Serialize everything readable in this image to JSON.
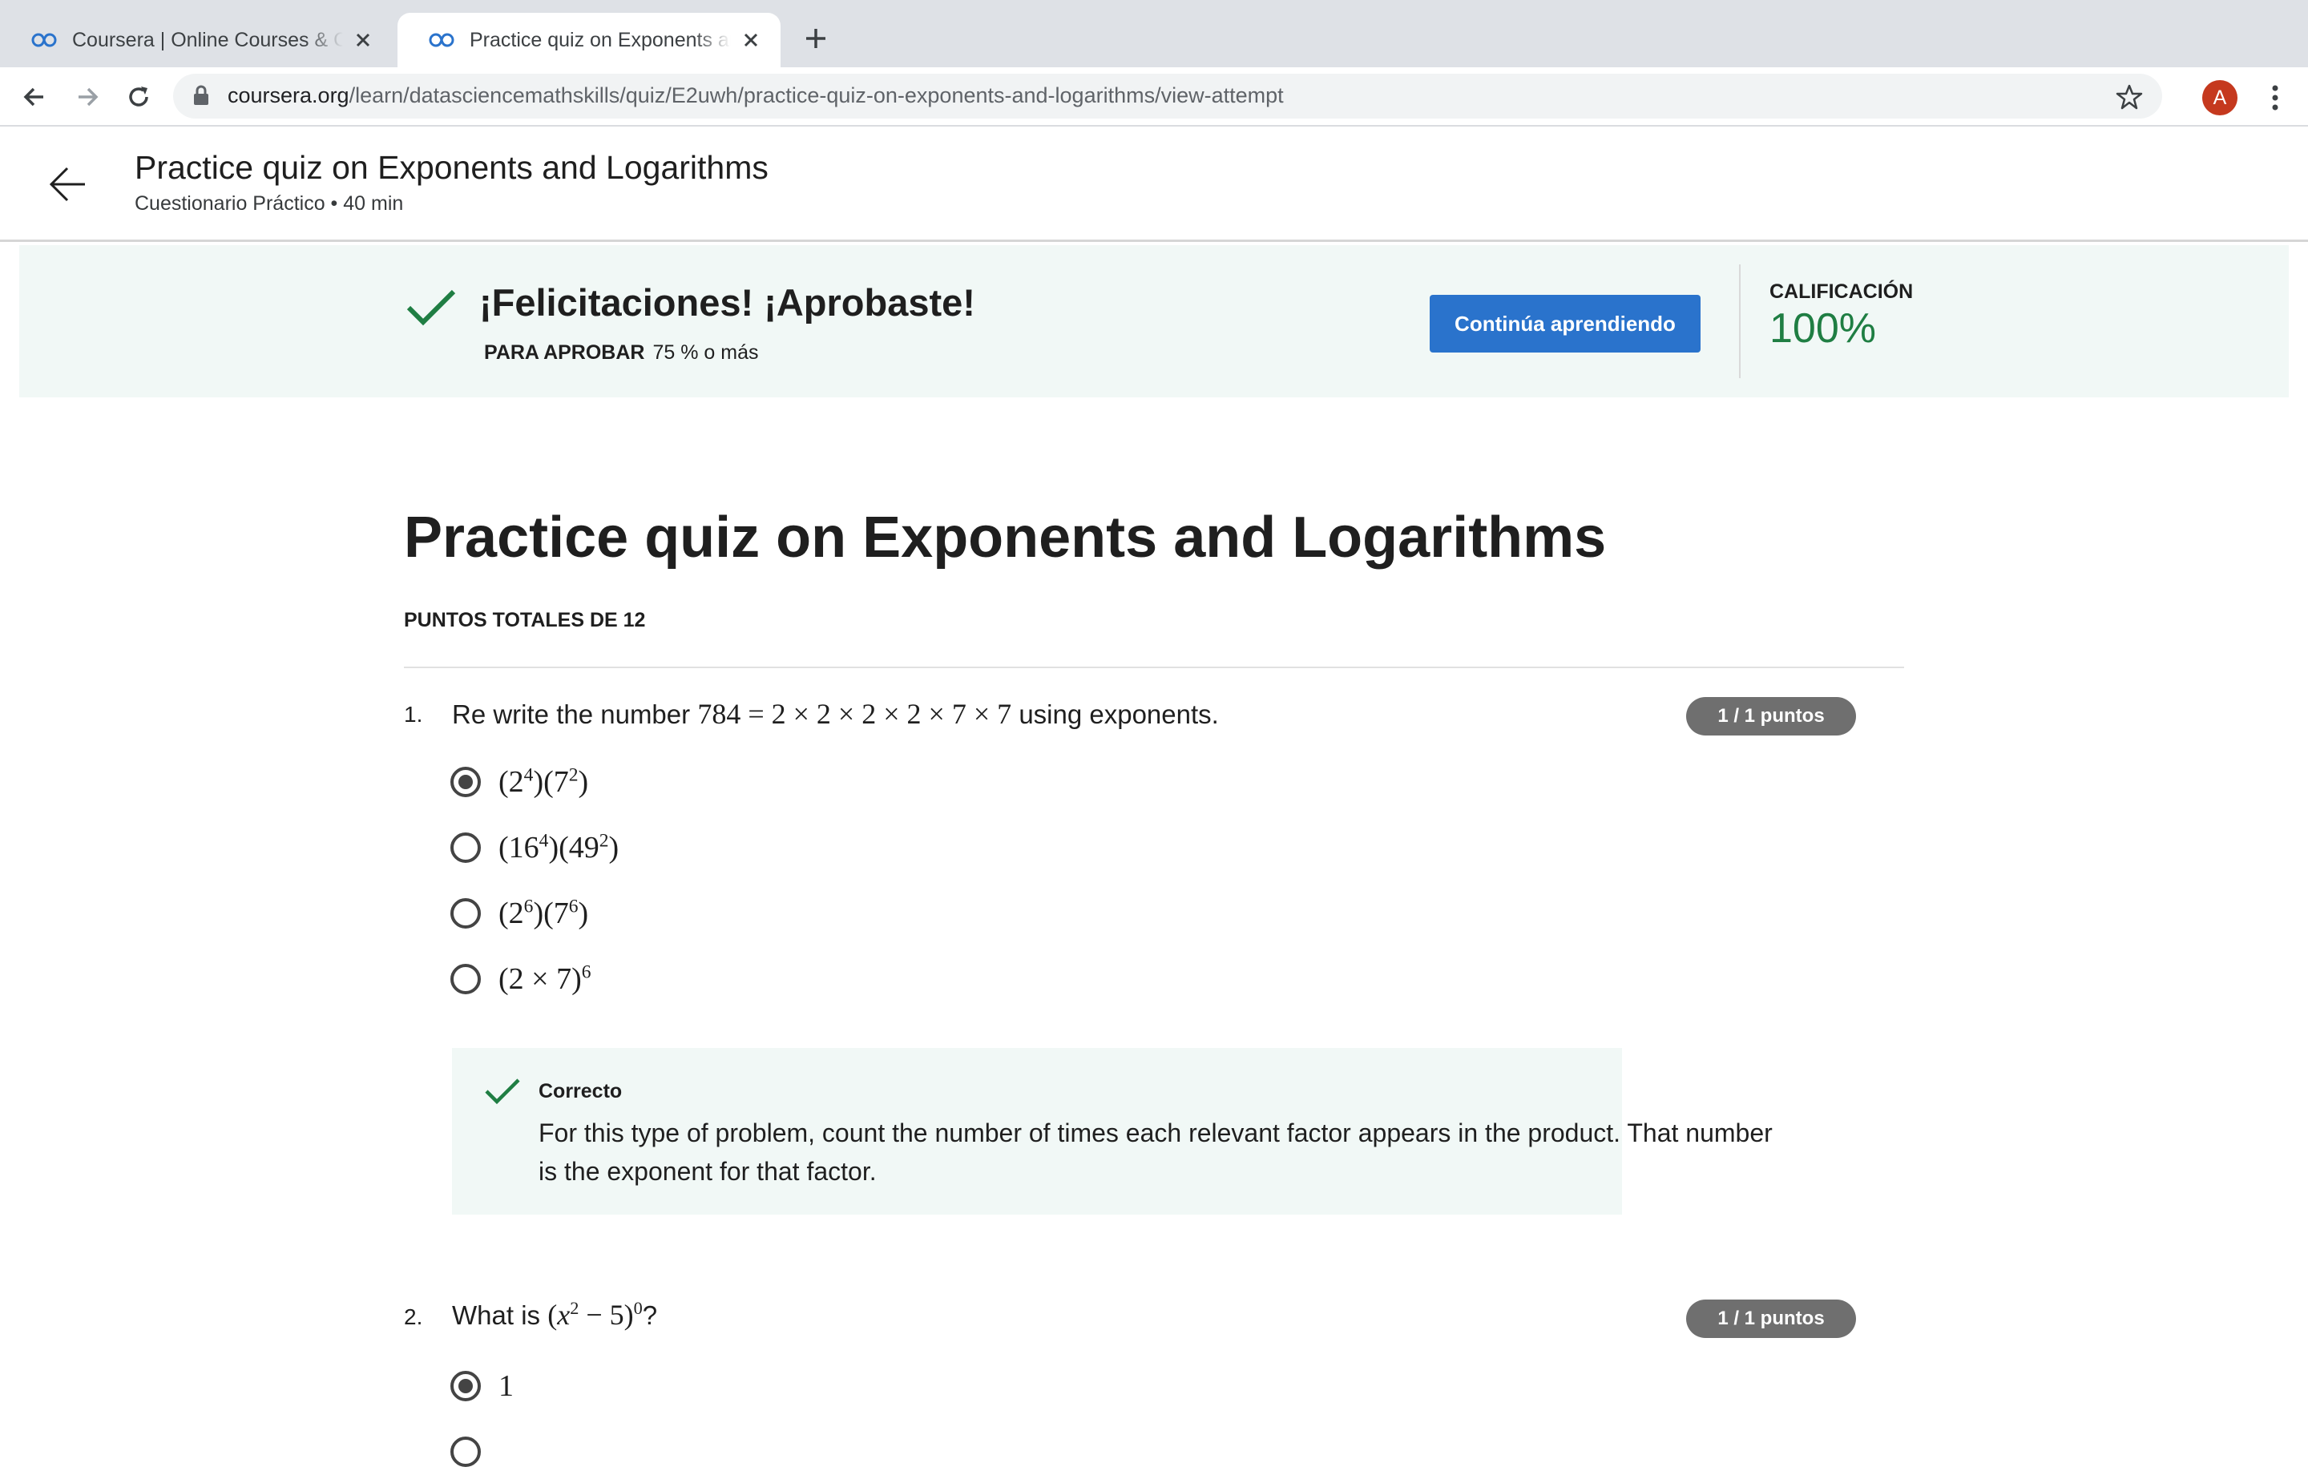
{
  "browser": {
    "tabs": [
      {
        "title": "Coursera | Online Courses & Credentials",
        "active": false
      },
      {
        "title": "Practice quiz on Exponents and Logarithms",
        "active": true
      }
    ],
    "url_host": "coursera.org",
    "url_path": "/learn/datasciencemathskills/quiz/E2uwh/practice-quiz-on-exponents-and-logarithms/view-attempt",
    "profile_initial": "A"
  },
  "header": {
    "title": "Practice quiz on Exponents and Logarithms",
    "subtitle": "Cuestionario Práctico • 40 min"
  },
  "banner": {
    "title": "¡Felicitaciones! ¡Aprobaste!",
    "pass_label": "PARA APROBAR",
    "pass_value": "75 % o más",
    "continue_label": "Continúa aprendiendo",
    "grade_label": "CALIFICACIÓN",
    "grade_value": "100%"
  },
  "quiz": {
    "title": "Practice quiz on Exponents and Logarithms",
    "total_points": "PUNTOS TOTALES DE 12",
    "questions": [
      {
        "number": "1.",
        "prefix": "Re write the number",
        "math": "784 = 2 × 2 × 2 × 2 × 7 × 7",
        "suffix": "using exponents.",
        "points": "1 / 1 puntos",
        "options": [
          {
            "text": "(2⁴)(7²)",
            "selected": true
          },
          {
            "text": "(16⁴)(49²)",
            "selected": false
          },
          {
            "text": "(2⁶)(7⁶)",
            "selected": false
          },
          {
            "text": "(2 × 7)⁶",
            "selected": false
          }
        ],
        "feedback": {
          "label": "Correcto",
          "text": "For this type of problem, count the number of times each relevant factor appears in the product. That number is the exponent for that factor."
        }
      },
      {
        "number": "2.",
        "prefix": "What is",
        "math": "(x² − 5)⁰",
        "suffix": "?",
        "points": "1 / 1 puntos",
        "options": [
          {
            "text": "1",
            "selected": true
          }
        ]
      }
    ]
  },
  "colors": {
    "accent": "#2a73cc",
    "success": "#1f7e43",
    "banner_bg": "#f1f8f6",
    "pill_bg": "#6f6f6f"
  },
  "icons": [
    "coursera-favicon-icon",
    "close-icon",
    "plus-icon",
    "back-icon",
    "forward-icon",
    "reload-icon",
    "lock-icon",
    "star-icon",
    "more-vert-icon",
    "arrow-left-icon",
    "checkmark-icon",
    "radio-icon"
  ]
}
